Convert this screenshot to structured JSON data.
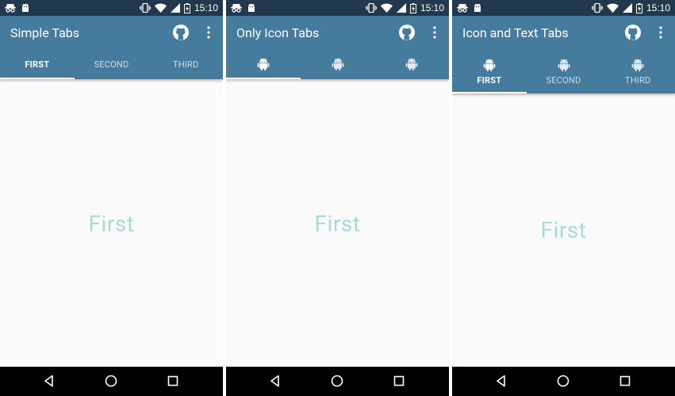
{
  "colors": {
    "status_bar": "#22384d",
    "app_bar": "#457b9d",
    "content_background": "#fafafa",
    "content_text": "#a8dadc",
    "nav_bar": "#000000"
  },
  "status_bar": {
    "time": "15:10",
    "left_icons": [
      "incognito-icon",
      "android-notification-icon"
    ],
    "right_icons": [
      "vibrate-icon",
      "wifi-icon",
      "cell-signal-icon",
      "battery-charging-icon"
    ]
  },
  "screens": [
    {
      "title": "Simple Tabs",
      "tab_style": "text",
      "tabs": [
        {
          "label": "FIRST",
          "active": true
        },
        {
          "label": "SECOND",
          "active": false
        },
        {
          "label": "THIRD",
          "active": false
        }
      ],
      "content_text": "First"
    },
    {
      "title": "Only Icon Tabs",
      "tab_style": "icon",
      "tabs": [
        {
          "icon": "android-icon",
          "active": true
        },
        {
          "icon": "android-icon",
          "active": false
        },
        {
          "icon": "android-icon",
          "active": false
        }
      ],
      "content_text": "First"
    },
    {
      "title": "Icon and Text Tabs",
      "tab_style": "icon-text",
      "tabs": [
        {
          "label": "FIRST",
          "icon": "android-icon",
          "active": true
        },
        {
          "label": "SECOND",
          "icon": "android-icon",
          "active": false
        },
        {
          "label": "THIRD",
          "icon": "android-icon",
          "active": false
        }
      ],
      "content_text": "First"
    }
  ],
  "toolbar_actions": [
    "github-icon",
    "more-vert-icon"
  ],
  "nav_buttons": [
    "back-icon",
    "home-icon",
    "recents-icon"
  ]
}
